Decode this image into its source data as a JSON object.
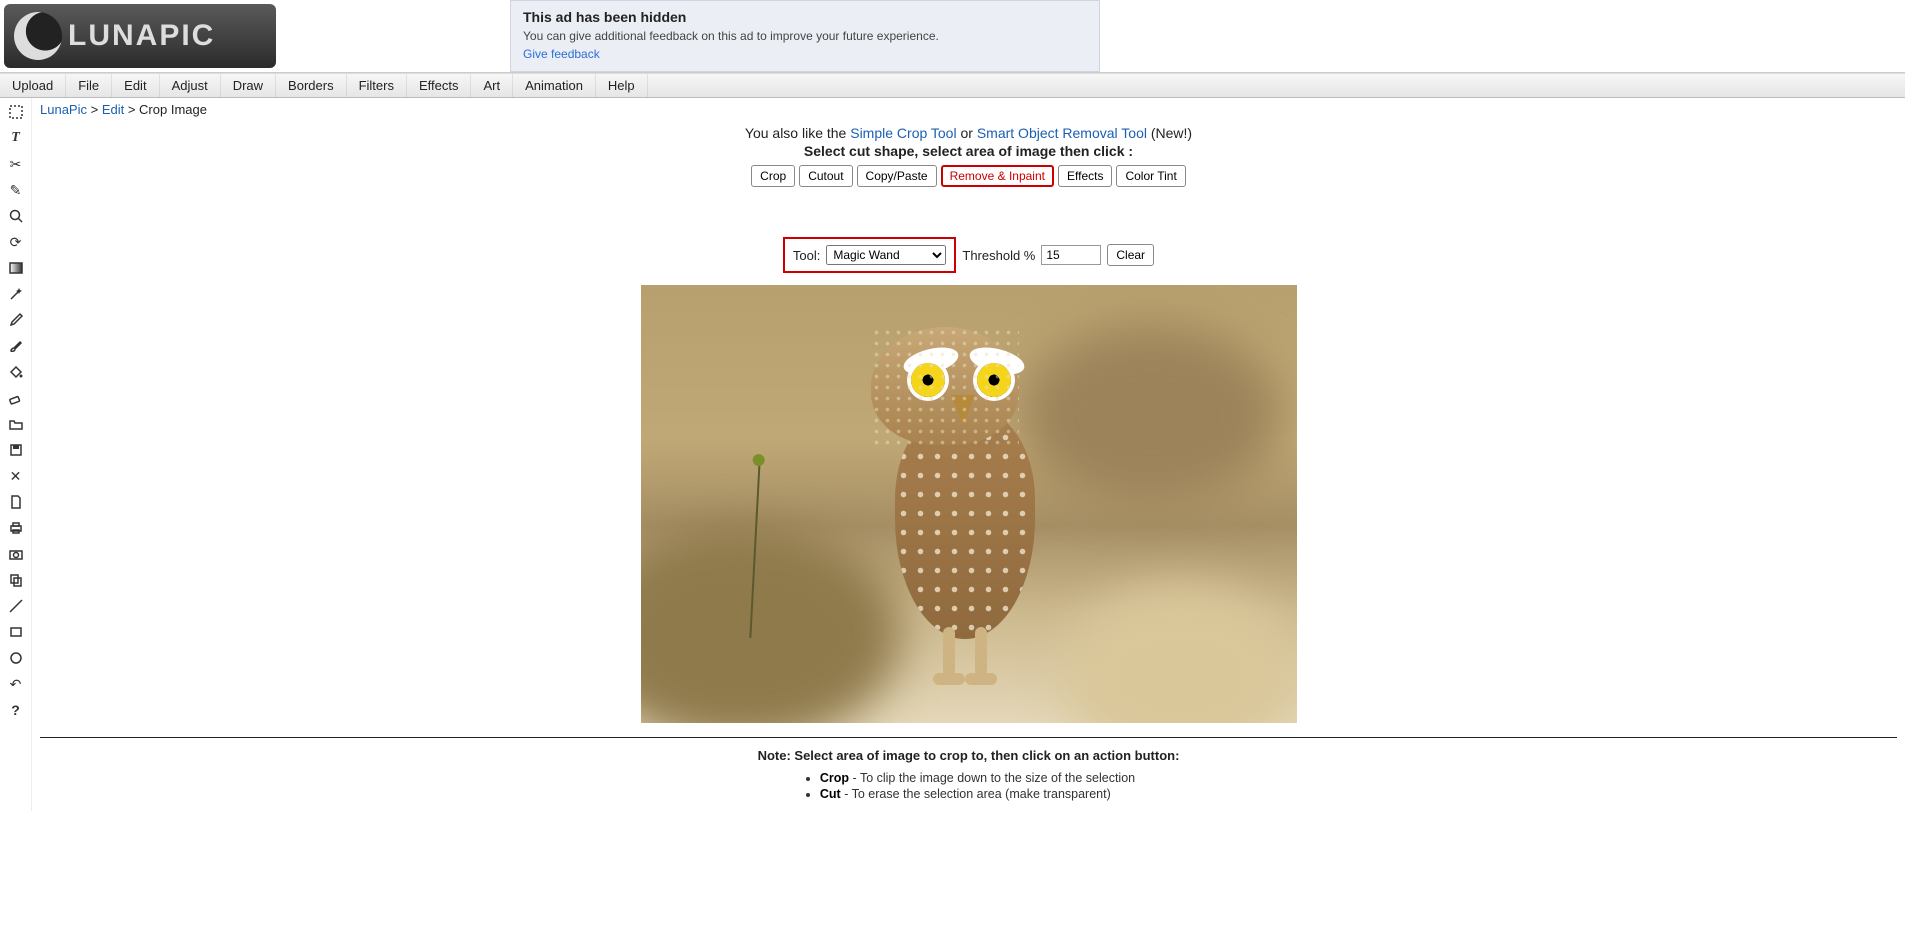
{
  "logo_text": "LUNAPIC",
  "ad": {
    "title": "This ad has been hidden",
    "desc": "You can give additional feedback on this ad to improve your future experience.",
    "link": "Give feedback"
  },
  "menu": [
    "Upload",
    "File",
    "Edit",
    "Adjust",
    "Draw",
    "Borders",
    "Filters",
    "Effects",
    "Art",
    "Animation",
    "Help"
  ],
  "breadcrumb": {
    "a1": "LunaPic",
    "sep1": " > ",
    "a2": "Edit",
    "sep2": " > ",
    "tail": "Crop Image"
  },
  "side_tools": [
    {
      "name": "select-rect"
    },
    {
      "name": "text-tool"
    },
    {
      "name": "scissors-icon"
    },
    {
      "name": "pen-icon"
    },
    {
      "name": "magnify-icon"
    },
    {
      "name": "rotate-icon"
    },
    {
      "name": "gradient-icon"
    },
    {
      "name": "wand-icon"
    },
    {
      "name": "eyedropper-icon"
    },
    {
      "name": "brush-icon"
    },
    {
      "name": "bucket-icon"
    },
    {
      "name": "eraser-icon"
    },
    {
      "name": "open-icon"
    },
    {
      "name": "save-icon"
    },
    {
      "name": "close-icon"
    },
    {
      "name": "page-icon"
    },
    {
      "name": "printer-icon"
    },
    {
      "name": "camera-icon"
    },
    {
      "name": "copy-icon"
    },
    {
      "name": "line-icon"
    },
    {
      "name": "rect-icon"
    },
    {
      "name": "circle-icon"
    },
    {
      "name": "undo-icon"
    },
    {
      "name": "help-icon"
    }
  ],
  "promo": {
    "prefix": "You also like the ",
    "link1": "Simple Crop Tool",
    "mid": " or ",
    "link2": "Smart Object Removal Tool",
    "suffix": " (New!)",
    "sub": "Select cut shape, select area of image then click :"
  },
  "actions": {
    "crop": "Crop",
    "cutout": "Cutout",
    "copypaste": "Copy/Paste",
    "remove": "Remove & Inpaint",
    "effects": "Effects",
    "colortint": "Color Tint"
  },
  "tool_row": {
    "label": "Tool:",
    "selected": "Magic Wand",
    "threshold_label": "Threshold %",
    "threshold_value": "15",
    "clear": "Clear"
  },
  "notes": {
    "title": "Note: Select area of image to crop to, then click on an action button:",
    "items": [
      {
        "b": "Crop",
        "t": " - To clip the image down to the size of the selection"
      },
      {
        "b": "Cut",
        "t": " - To erase the selection area (make transparent)"
      }
    ]
  }
}
